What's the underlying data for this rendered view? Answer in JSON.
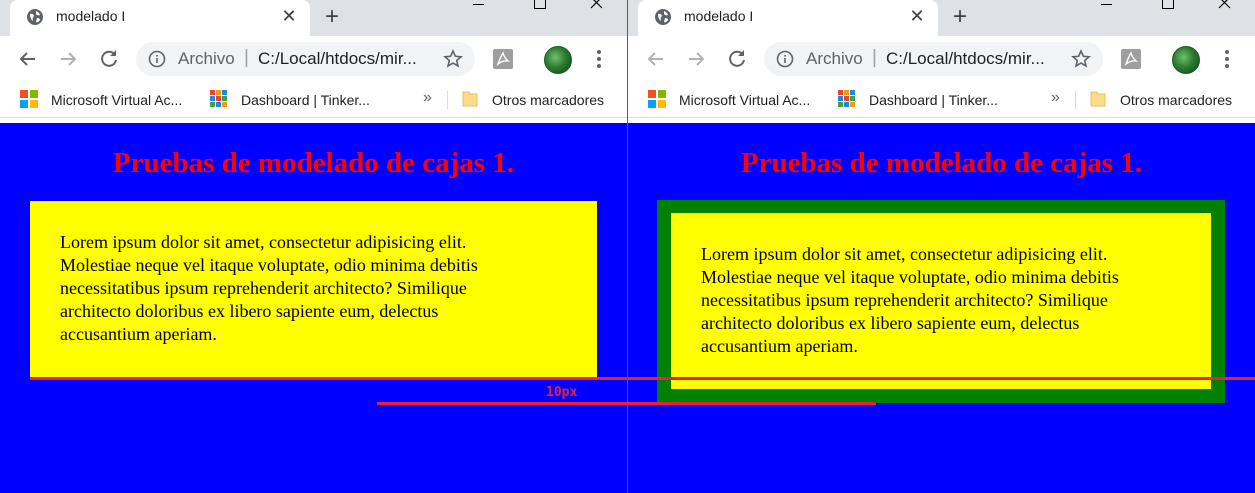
{
  "windows": [
    {
      "tab": {
        "title": "modelado I",
        "close": "✕"
      },
      "new_tab": "+",
      "omnibox": {
        "scheme": "Archivo",
        "separator": "|",
        "url": "C:/Local/htdocs/mir..."
      },
      "bookmarks": [
        {
          "label": "Microsoft Virtual Ac...",
          "icon": "microsoft-logo-icon"
        },
        {
          "label": "Dashboard | Tinker...",
          "icon": "tinkercad-icon"
        }
      ],
      "bookmarks_overflow": "»",
      "other_bookmarks": "Otros marcadores",
      "page": {
        "title": "Pruebas de modelado de cajas 1.",
        "paragraph": "Lorem ipsum dolor sit amet, consectetur adipisicing elit. Molestiae neque vel itaque voluptate, odio minima debitis necessitatibus ipsum reprehenderit architecto? Similique architecto doloribus ex libero sapiente eum, delectus accusantium aperiam."
      }
    },
    {
      "tab": {
        "title": "modelado I",
        "close": "✕"
      },
      "new_tab": "+",
      "omnibox": {
        "scheme": "Archivo",
        "separator": "|",
        "url": "C:/Local/htdocs/mir..."
      },
      "bookmarks": [
        {
          "label": "Microsoft Virtual Ac...",
          "icon": "microsoft-logo-icon"
        },
        {
          "label": "Dashboard | Tinker...",
          "icon": "tinkercad-icon"
        }
      ],
      "bookmarks_overflow": "»",
      "other_bookmarks": "Otros marcadores",
      "page": {
        "title": "Pruebas de modelado de cajas 1.",
        "paragraph": "Lorem ipsum dolor sit amet, consectetur adipisicing elit. Molestiae neque vel itaque voluptate, odio minima debitis necessitatibus ipsum reprehenderit architecto? Similique architecto doloribus ex libero sapiente eum, delectus accusantium aperiam."
      }
    }
  ],
  "annotation": {
    "label": "10px"
  },
  "colors": {
    "page_background": "#0000ff",
    "title": "#ff0000",
    "box_background": "#ffff00",
    "box_border": "#008000",
    "annotation": "#e8213a",
    "tab_strip": "#dee1e6"
  }
}
